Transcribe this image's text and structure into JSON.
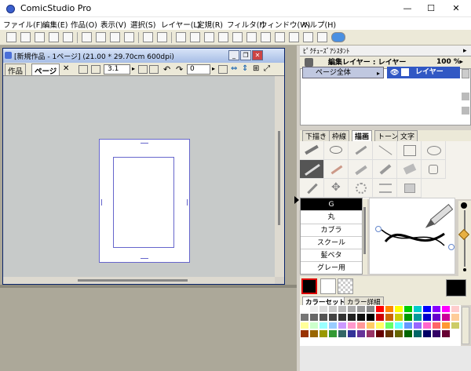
{
  "title": "ComicStudio Pro",
  "window_controls": [
    "—",
    "☐",
    "✕"
  ],
  "menu": [
    "ファイル(F)",
    "編集(E)",
    "作品(O)",
    "表示(V)",
    "選択(S)",
    "レイヤー(L)",
    "定規(R)",
    "フィルタ(I)",
    "ウィンドウ(W)",
    "ヘルプ(H)"
  ],
  "document": {
    "title": "[新規作品 - 1ページ] (21.00 * 29.70cm 600dpi)",
    "tabs": [
      "作品",
      "ページ"
    ],
    "zoom": "3.1",
    "rotation": "0"
  },
  "properties_assistant": "ﾋﾟｸﾁｭｰｽﾞｱｼｽﾀﾝﾄ",
  "layer_panel": {
    "edit_layer_label": "編集レイヤー : レイヤー",
    "opacity": "100 %",
    "page_all": "ページ全体",
    "layer_name": "レイヤー"
  },
  "tool_tabs": [
    "下描き",
    "枠線",
    "描画",
    "トーン",
    "文字"
  ],
  "pens": [
    "G",
    "丸",
    "カブラ",
    "スクール",
    "髪ベタ",
    "グレー用"
  ],
  "color_tabs": [
    "カラーセット",
    "カラー詳細"
  ],
  "palette": [
    "#ffffff",
    "#eeeeee",
    "#dddddd",
    "#cccccc",
    "#bbbbbb",
    "#aaaaaa",
    "#999999",
    "#888888",
    "#ff0000",
    "#ff8800",
    "#ffff00",
    "#00cc00",
    "#00cccc",
    "#0000ff",
    "#8800ff",
    "#ff00ff",
    "#ffcccc",
    "#777777",
    "#666666",
    "#555555",
    "#444444",
    "#333333",
    "#222222",
    "#111111",
    "#000000",
    "#cc0000",
    "#cc6600",
    "#cccc00",
    "#009900",
    "#009999",
    "#0000cc",
    "#6600cc",
    "#cc0099",
    "#ffcc99",
    "#ffff99",
    "#ccffcc",
    "#99ffff",
    "#99ccff",
    "#cc99ff",
    "#ff99cc",
    "#ff9999",
    "#ffcc66",
    "#ffff66",
    "#66ff66",
    "#66ffff",
    "#6699ff",
    "#9966ff",
    "#ff66cc",
    "#ff6666",
    "#ff9933",
    "#cccc66",
    "#993300",
    "#996600",
    "#999900",
    "#339933",
    "#336666",
    "#333399",
    "#663399",
    "#993366",
    "#660000",
    "#663300",
    "#666600",
    "#006600",
    "#006666",
    "#000066",
    "#330066",
    "#660033",
    "#ffffff"
  ]
}
